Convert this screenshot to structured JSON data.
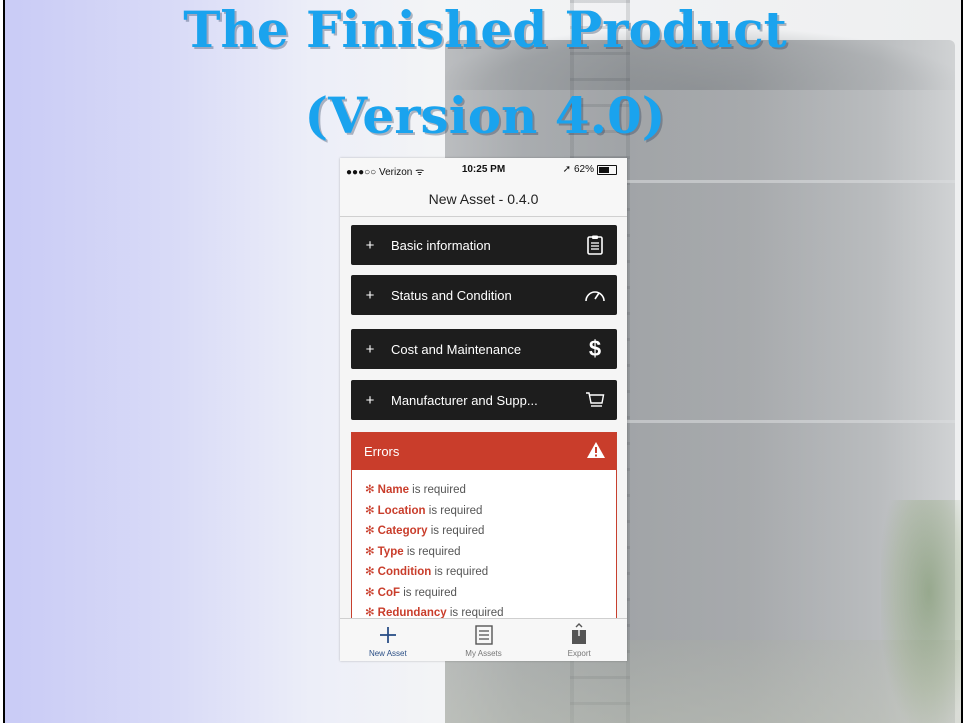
{
  "slide": {
    "title_line1": "The Finished Product",
    "title_line2": "(Version 4.0)",
    "title_color": "#1aa3ee"
  },
  "phone": {
    "statusbar": {
      "carrier": "●●●○○ Verizon ᯤ",
      "time": "10:25 PM",
      "location_glyph": "➚",
      "battery_text": "62%",
      "battery_level": 0.62
    },
    "nav_title": "New Asset - 0.4.0",
    "sections": [
      {
        "plus": "+",
        "label": "Basic information",
        "icon": "clipboard-icon"
      },
      {
        "plus": "+",
        "label": "Status and Condition",
        "icon": "gauge-icon"
      },
      {
        "plus": "+",
        "label": "Cost and Maintenance",
        "icon": "dollar-icon",
        "glyph": "$"
      },
      {
        "plus": "+",
        "label": "Manufacturer and Supp...",
        "icon": "cart-icon"
      }
    ],
    "errors": {
      "title": "Errors",
      "icon": "warning-icon",
      "accent": "#c93d2b",
      "bullet": "✻",
      "required_suffix": "is required",
      "items": [
        {
          "field": "Name",
          "suffix": " is required"
        },
        {
          "field": "Location",
          "suffix": " is required"
        },
        {
          "field": "Category",
          "suffix": " is required"
        },
        {
          "field": "Type",
          "suffix": " is required"
        },
        {
          "field": "Condition",
          "suffix": " is required"
        },
        {
          "field": "CoF",
          "suffix": " is required"
        },
        {
          "field": "Redundancy",
          "suffix": " is required"
        }
      ]
    },
    "tabs": [
      {
        "label": "New Asset",
        "icon": "plus-icon",
        "active": true
      },
      {
        "label": "My Assets",
        "icon": "list-icon",
        "active": false
      },
      {
        "label": "Export",
        "icon": "export-icon",
        "active": false
      }
    ]
  }
}
